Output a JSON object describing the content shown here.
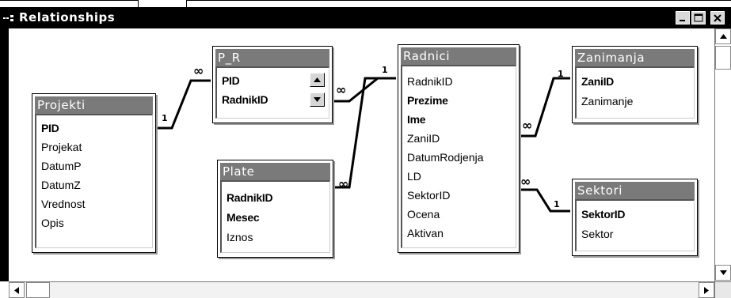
{
  "window": {
    "title": "Relationships",
    "buttons": {
      "minimize": "minimize",
      "maximize": "maximize",
      "close": "close"
    }
  },
  "tables": {
    "projekti": {
      "name": "Projekti",
      "fields": [
        "PID",
        "Projekat",
        "DatumP",
        "DatumZ",
        "Vrednost",
        "Opis"
      ]
    },
    "p_r": {
      "name": "P_R",
      "fields": [
        "PID",
        "RadnikID"
      ]
    },
    "plate": {
      "name": "Plate",
      "fields": [
        "RadnikID",
        "Mesec",
        "Iznos"
      ]
    },
    "radnici": {
      "name": "Radnici",
      "fields": [
        "RadnikID",
        "Prezime",
        "Ime",
        "ZaniID",
        "DatumRodjenja",
        "LD",
        "SektorID",
        "Ocena",
        "Aktivan"
      ]
    },
    "zanimanja": {
      "name": "Zanimanja",
      "fields": [
        "ZaniID",
        "Zanimanje"
      ]
    },
    "sektori": {
      "name": "Sektori",
      "fields": [
        "SektorID",
        "Sektor"
      ]
    }
  },
  "relationships": [
    {
      "from": "Projekti.PID",
      "to": "P_R.PID",
      "one": "1",
      "many": "∞"
    },
    {
      "from": "Radnici.RadnikID",
      "to": "P_R.RadnikID",
      "one": "1",
      "many": "∞"
    },
    {
      "from": "Radnici.RadnikID",
      "to": "Plate.RadnikID",
      "one": "1",
      "many": "∞"
    },
    {
      "from": "Zanimanja.ZaniID",
      "to": "Radnici.ZaniID",
      "one": "1",
      "many": "∞"
    },
    {
      "from": "Sektori.SektorID",
      "to": "Radnici.SektorID",
      "one": "1",
      "many": "∞"
    }
  ],
  "icons": {
    "window": "relationships-icon",
    "scroll_up": "arrow-up-icon",
    "scroll_down": "arrow-down-icon",
    "scroll_left": "arrow-left-icon",
    "scroll_right": "arrow-right-icon"
  }
}
